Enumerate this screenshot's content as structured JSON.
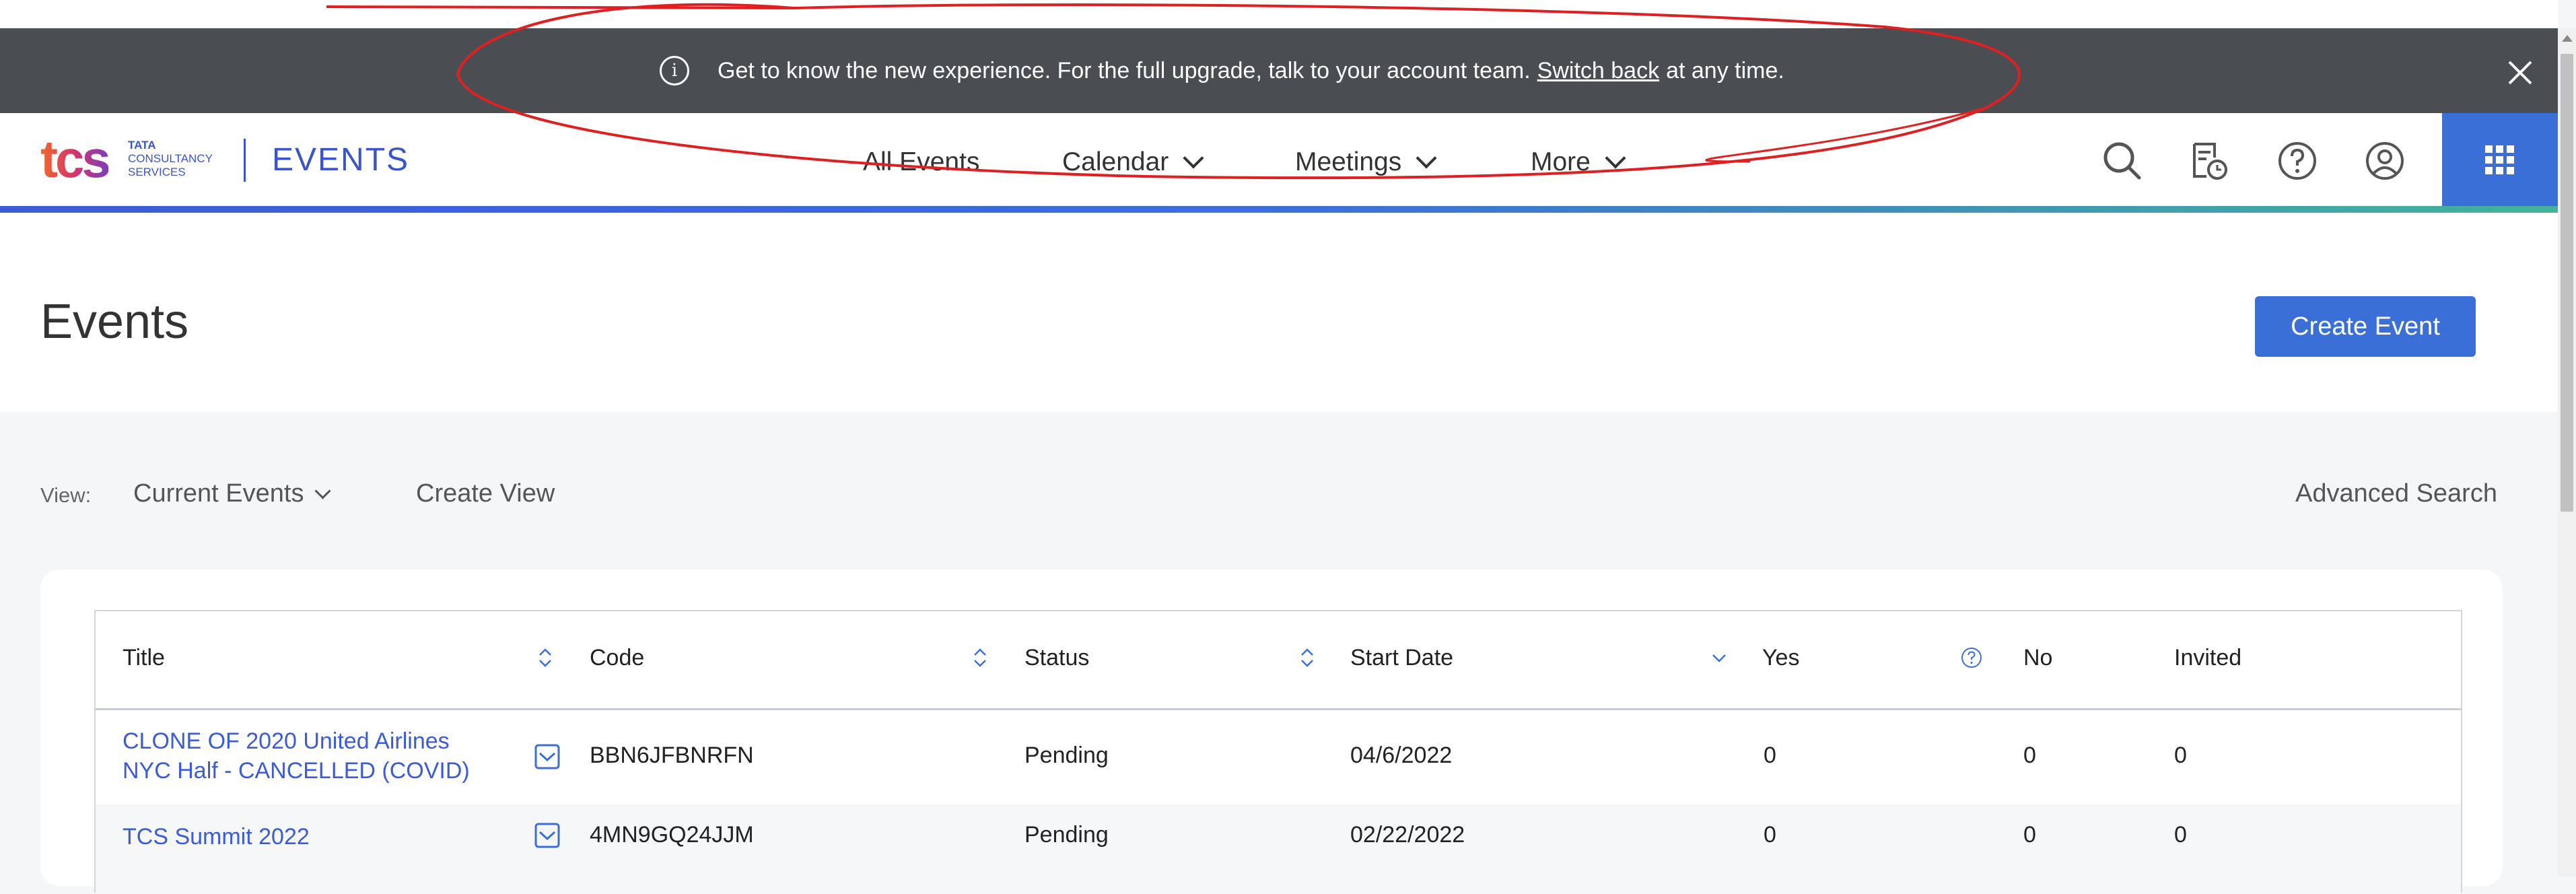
{
  "banner": {
    "message": "Get to know the new experience. For the full upgrade, talk to your account team.",
    "switch_link": "Switch back",
    "suffix": "at any time."
  },
  "header": {
    "logo_text": "tcs",
    "logo_line1": "TATA",
    "logo_line2": "CONSULTANCY",
    "logo_line3": "SERVICES",
    "app_name": "EVENTS",
    "nav": {
      "all_events": "All Events",
      "calendar": "Calendar",
      "meetings": "Meetings",
      "more": "More"
    }
  },
  "page": {
    "title": "Events",
    "create_button": "Create Event"
  },
  "viewbar": {
    "label": "View:",
    "selected_view": "Current Events",
    "create_view": "Create View",
    "advanced_search": "Advanced Search"
  },
  "table": {
    "columns": {
      "title": "Title",
      "code": "Code",
      "status": "Status",
      "start_date": "Start Date",
      "yes": "Yes",
      "no": "No",
      "invited": "Invited"
    },
    "rows": [
      {
        "title": "CLONE OF 2020 United Airlines NYC Half - CANCELLED (COVID)",
        "code": "BBN6JFBNRFN",
        "status": "Pending",
        "start_date": "04/6/2022",
        "yes": "0",
        "no": "0",
        "invited": "0"
      },
      {
        "title": "TCS Summit 2022",
        "code": "4MN9GQ24JJM",
        "status": "Pending",
        "start_date": "02/22/2022",
        "yes": "0",
        "no": "0",
        "invited": "0"
      }
    ]
  },
  "colors": {
    "accent": "#3b6fd8",
    "banner_bg": "#4a4d52",
    "link": "#3b5bdb",
    "annotation": "#e02020"
  },
  "icons": [
    "info-icon",
    "close-icon",
    "search-icon",
    "report-clock-icon",
    "help-icon",
    "user-icon",
    "app-grid-icon",
    "sort-icon",
    "sort-down-icon",
    "question-circle-icon",
    "email-icon",
    "chevron-down-icon"
  ]
}
